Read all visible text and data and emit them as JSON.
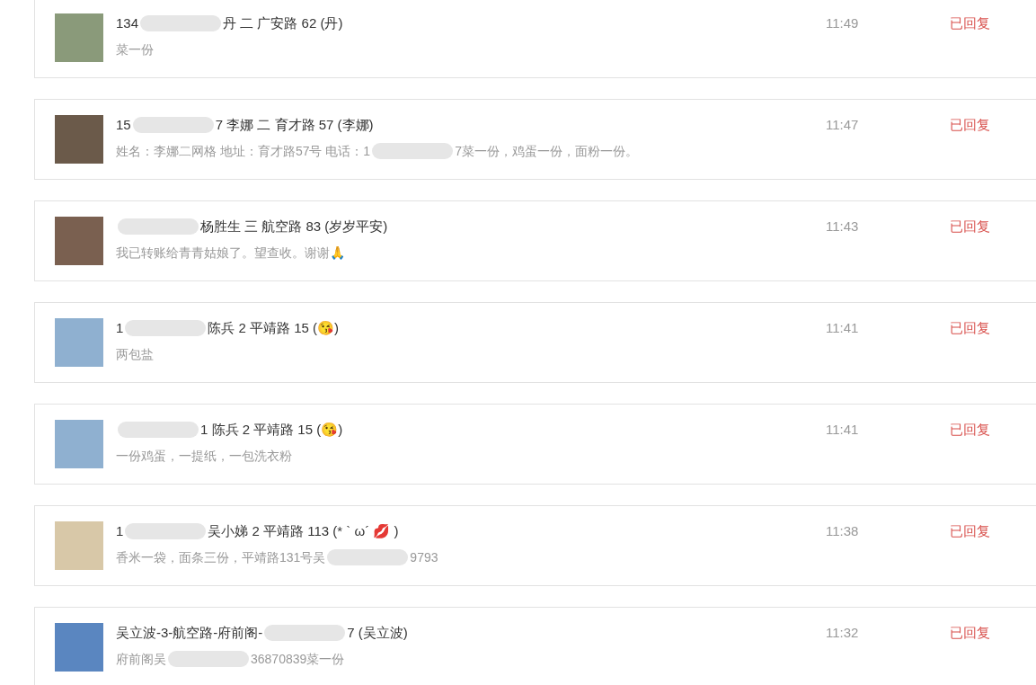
{
  "messages": [
    {
      "title": [
        {
          "kind": "text",
          "text": "134"
        },
        {
          "kind": "redacted"
        },
        {
          "kind": "text",
          "text": "丹 二 广安路 62 (丹)"
        }
      ],
      "message": [
        {
          "kind": "text",
          "text": "菜一份"
        }
      ],
      "time": "11:49",
      "status": "已回复"
    },
    {
      "title": [
        {
          "kind": "text",
          "text": "15"
        },
        {
          "kind": "redacted"
        },
        {
          "kind": "text",
          "text": "7 李娜 二 育才路 57 (李娜)"
        }
      ],
      "message": [
        {
          "kind": "text",
          "text": "姓名：李娜二网格 地址：育才路57号 电话：1"
        },
        {
          "kind": "redacted"
        },
        {
          "kind": "text",
          "text": "7菜一份，鸡蛋一份，面粉一份。"
        }
      ],
      "time": "11:47",
      "status": "已回复"
    },
    {
      "title": [
        {
          "kind": "redacted"
        },
        {
          "kind": "text",
          "text": "杨胜生 三 航空路 83 (岁岁平安)"
        }
      ],
      "message": [
        {
          "kind": "text",
          "text": "我已转账给青青姑娘了。望查收。谢谢🙏"
        }
      ],
      "time": "11:43",
      "status": "已回复"
    },
    {
      "title": [
        {
          "kind": "text",
          "text": "1"
        },
        {
          "kind": "redacted"
        },
        {
          "kind": "text",
          "text": "陈兵 2 平靖路 15 (😘)"
        }
      ],
      "message": [
        {
          "kind": "text",
          "text": "两包盐"
        }
      ],
      "time": "11:41",
      "status": "已回复"
    },
    {
      "title": [
        {
          "kind": "redacted"
        },
        {
          "kind": "text",
          "text": "1 陈兵 2 平靖路 15 (😘)"
        }
      ],
      "message": [
        {
          "kind": "text",
          "text": "一份鸡蛋，一提纸，一包洗衣粉"
        }
      ],
      "time": "11:41",
      "status": "已回复"
    },
    {
      "title": [
        {
          "kind": "text",
          "text": "1"
        },
        {
          "kind": "redacted"
        },
        {
          "kind": "text",
          "text": "吴小娣 2 平靖路 113 (* ` ω´ 💋 )"
        }
      ],
      "message": [
        {
          "kind": "text",
          "text": "香米一袋，面条三份，平靖路131号吴"
        },
        {
          "kind": "redacted"
        },
        {
          "kind": "text",
          "text": "9793"
        }
      ],
      "time": "11:38",
      "status": "已回复"
    },
    {
      "title": [
        {
          "kind": "text",
          "text": "吴立波-3-航空路-府前阁-"
        },
        {
          "kind": "redacted"
        },
        {
          "kind": "text",
          "text": "7 (吴立波)"
        }
      ],
      "message": [
        {
          "kind": "text",
          "text": "府前阁吴"
        },
        {
          "kind": "redacted"
        },
        {
          "kind": "text",
          "text": "36870839菜一份"
        }
      ],
      "time": "11:32",
      "status": "已回复"
    }
  ]
}
